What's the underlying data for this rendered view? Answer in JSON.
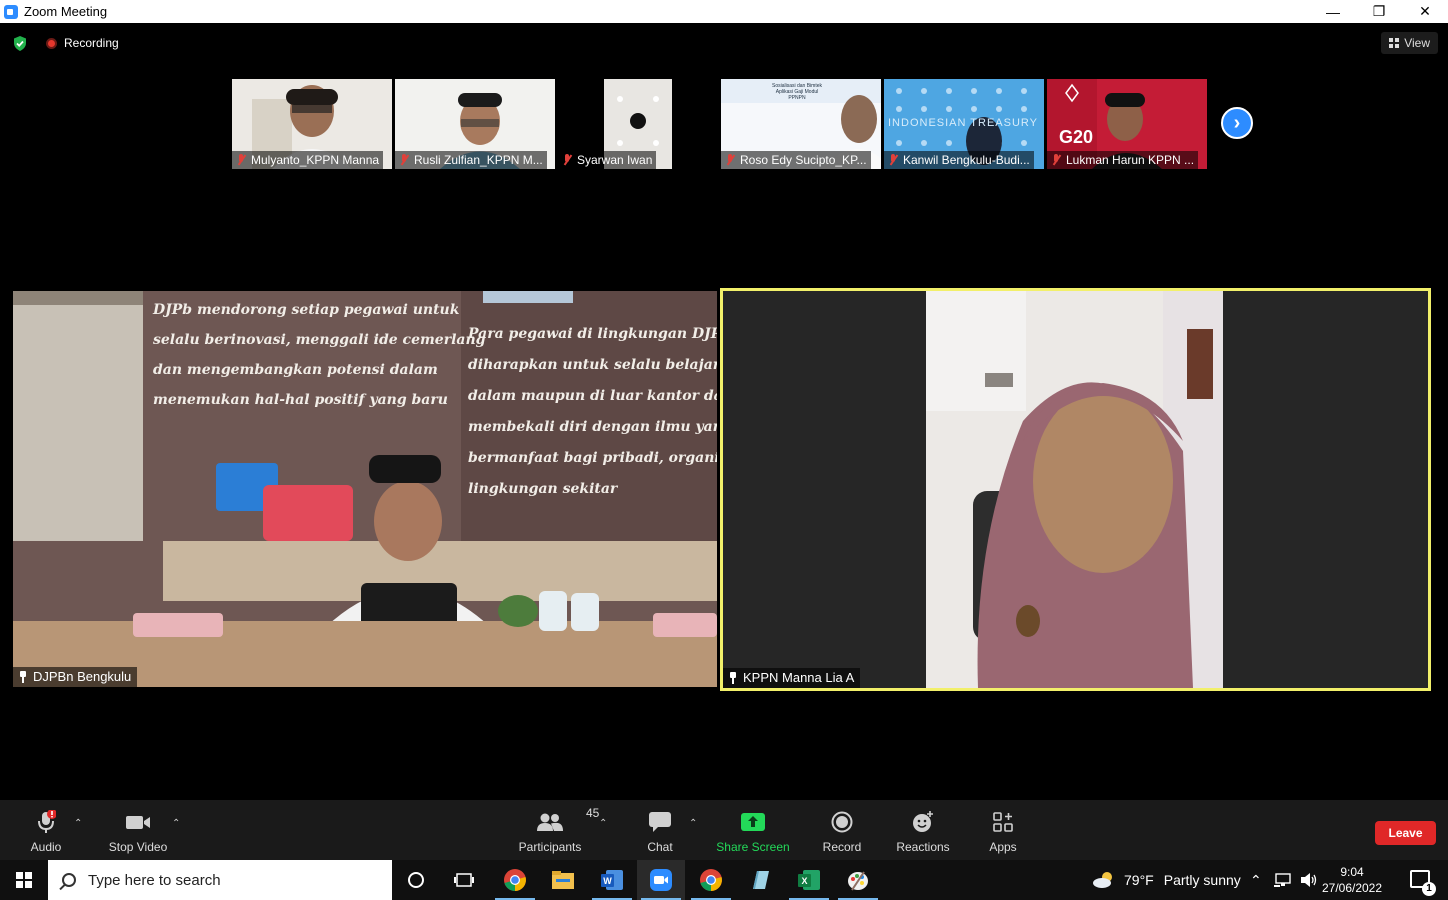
{
  "window": {
    "title": "Zoom Meeting",
    "minimize": "—",
    "restore": "❐",
    "close": "✕"
  },
  "topbar": {
    "recording_label": "Recording",
    "view_label": "View"
  },
  "participants_strip": [
    {
      "name": "Mulyanto_KPPN Manna"
    },
    {
      "name": "Rusli Zulfian_KPPN M..."
    },
    {
      "name": "Syarwan Iwan"
    },
    {
      "name": "Roso Edy Sucipto_KP..."
    },
    {
      "name": "Kanwil Bengkulu-Budi..."
    },
    {
      "name": "Lukman Harun KPPN ..."
    }
  ],
  "thumb_texts": {
    "slide_title": "Sosialisasi dan Bimtek Aplikasi Gaji Modul PPNPN",
    "treasury": "INDONESIAN TREASURY",
    "g20": "G20"
  },
  "main_videos": {
    "left": {
      "name": "DJPBn Bengkulu",
      "wall_text_1": [
        "DJPb mendorong setiap pegawai untuk",
        "selalu berinovasi, menggali ide cemerlang",
        "dan mengembangkan potensi dalam",
        "menemukan hal-hal positif yang baru"
      ],
      "wall_text_2": [
        "Para pegawai di lingkungan DJP",
        "diharapkan untuk selalu belajar",
        "dalam maupun di luar kantor da",
        "membekali diri dengan ilmu yan",
        "bermanfaat bagi pribadi, organi",
        "lingkungan sekitar"
      ]
    },
    "right": {
      "name": "KPPN Manna Lia A",
      "active_speaker_color": "#f2f06a"
    }
  },
  "toolbar": {
    "audio": "Audio",
    "stop_video": "Stop Video",
    "participants": "Participants",
    "participants_count": "45",
    "chat": "Chat",
    "share_screen": "Share Screen",
    "record": "Record",
    "reactions": "Reactions",
    "apps": "Apps",
    "leave": "Leave",
    "share_color": "#23d959",
    "leave_color": "#e02828"
  },
  "taskbar": {
    "search_placeholder": "Type here to search",
    "weather_temp": "79°F",
    "weather_desc": "Partly sunny",
    "time": "9:04",
    "date": "27/06/2022",
    "notification_count": "1",
    "apps": [
      "cortana-icon",
      "task-view-icon",
      "chrome-icon",
      "file-explorer-icon",
      "word-icon",
      "zoom-icon",
      "chrome-icon",
      "notepad-icon",
      "excel-icon",
      "paint-icon"
    ]
  }
}
